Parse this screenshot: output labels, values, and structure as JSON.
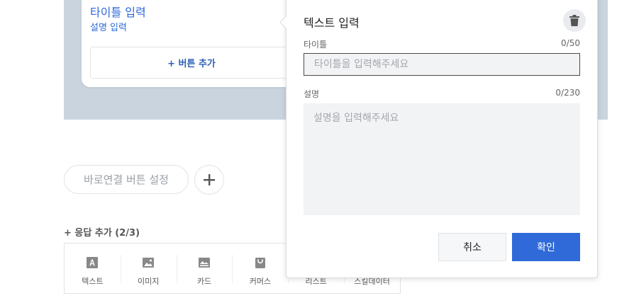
{
  "preview": {
    "card_title": "타이틀 입력",
    "card_description": "설명 입력",
    "add_button_label": "+ 버튼 추가"
  },
  "quick_link": {
    "button_label": "바로연결 버튼 설정",
    "plus_icon": "plus-icon"
  },
  "response": {
    "add_label": "+ 응답 추가 (2/3)",
    "types": [
      {
        "label": "텍스트",
        "icon": "text-icon"
      },
      {
        "label": "이미지",
        "icon": "image-icon"
      },
      {
        "label": "카드",
        "icon": "card-icon"
      },
      {
        "label": "커머스",
        "icon": "commerce-icon"
      },
      {
        "label": "리스트",
        "icon": "list-icon"
      },
      {
        "label": "스킬데이터",
        "icon": "skill-data-icon"
      }
    ]
  },
  "editor": {
    "title": "텍스트 입력",
    "delete_icon": "trash-icon",
    "title_field": {
      "label": "타이틀",
      "counter": "0/50",
      "value": "",
      "placeholder": "타이틀을 입력해주세요"
    },
    "description_field": {
      "label": "설명",
      "counter": "0/230",
      "value": "",
      "placeholder": "설명을 입력해주세요"
    },
    "cancel_label": "취소",
    "confirm_label": "확인"
  },
  "colors": {
    "accent": "#2f6ad8",
    "preview_background": "#c9d4de",
    "field_background": "#f2f3f5"
  }
}
